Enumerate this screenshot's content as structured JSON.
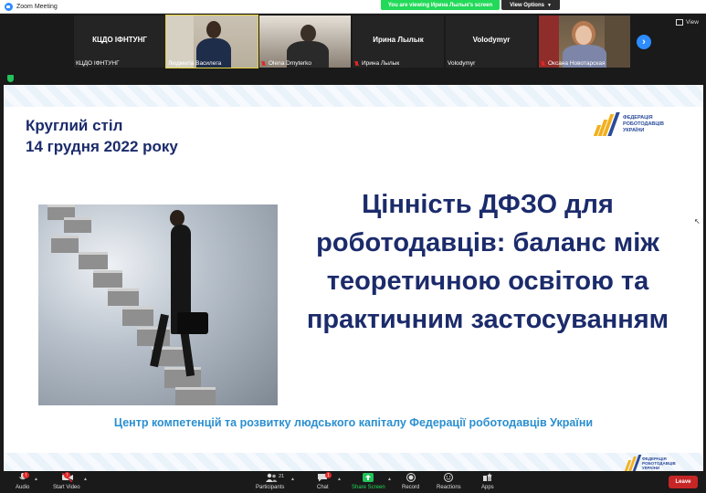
{
  "window": {
    "title": "Zoom Meeting",
    "viewing_banner": "You are viewing Ирина Лылык's screen",
    "view_options": "View Options"
  },
  "gallery": {
    "view_label": "View",
    "tiles": [
      {
        "center_name": "КЦДО ІФНТУНГ",
        "caption": "КЦДО ІФНТУНГ",
        "muted": false
      },
      {
        "center_name": "",
        "caption": "Людмила Василега",
        "muted": false
      },
      {
        "center_name": "",
        "caption": "Olena Dmyterko",
        "muted": true
      },
      {
        "center_name": "Ирина Лылык",
        "caption": "Ирина Лылык",
        "muted": true
      },
      {
        "center_name": "Volodymyr",
        "caption": "Volodymyr",
        "muted": false
      },
      {
        "center_name": "",
        "caption": "Оксана Новотарская",
        "muted": true
      }
    ]
  },
  "slide": {
    "round_table": "Круглий стіл",
    "date": "14 грудня 2022 року",
    "logo": {
      "line1": "ФЕДЕРАЦІЯ",
      "line2": "РОБОТОДАВЦІВ",
      "line3": "УКРАЇНИ"
    },
    "title_lines": [
      "Цінність ДФЗО для",
      "роботодавців: баланс між",
      "теоретичною освітою та",
      "практичним застосуванням"
    ],
    "center_line": "Центр компетенцій та розвитку людського капіталу  Федерації роботодавців України"
  },
  "toolbar": {
    "audio": "Audio",
    "start_video": "Start Video",
    "participants": "Participants",
    "participants_count": "21",
    "chat": "Chat",
    "chat_badge": "1",
    "share_screen": "Share Screen",
    "record": "Record",
    "reactions": "Reactions",
    "apps": "Apps",
    "leave": "Leave",
    "audio_badge": "!",
    "video_badge": "!"
  },
  "colors": {
    "slide_title": "#1b2b6b",
    "center_line": "#2a8fd0",
    "share_green": "#23d959",
    "leave_red": "#c72626",
    "zoom_blue": "#2d8cff"
  }
}
